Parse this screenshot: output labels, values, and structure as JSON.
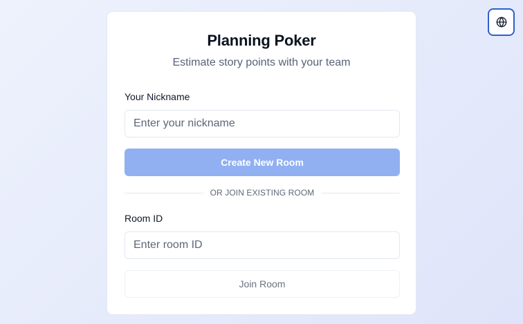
{
  "header": {
    "language_icon": "globe-icon"
  },
  "card": {
    "title": "Planning Poker",
    "subtitle": "Estimate story points with your team"
  },
  "create": {
    "nickname_label": "Your Nickname",
    "nickname_placeholder": "Enter your nickname",
    "nickname_value": "",
    "button_label": "Create New Room"
  },
  "divider": {
    "text": "OR JOIN EXISTING ROOM"
  },
  "join": {
    "room_label": "Room ID",
    "room_placeholder": "Enter room ID",
    "room_value": "",
    "button_label": "Join Room"
  },
  "colors": {
    "accent": "#91b0f2",
    "language_button_border": "#2f5fca",
    "background": "#e6ebfb"
  }
}
